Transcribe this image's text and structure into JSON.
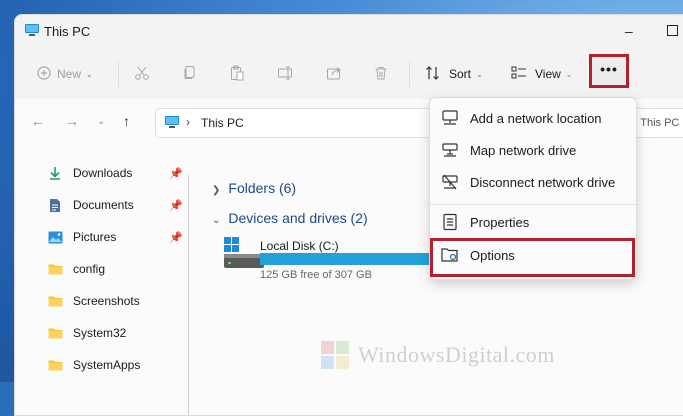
{
  "window": {
    "title": "This PC"
  },
  "toolbar": {
    "new_label": "New",
    "sort_label": "Sort",
    "view_label": "View",
    "more_label": "•••"
  },
  "address": {
    "location": "This PC",
    "search_placeholder": "arch This PC"
  },
  "sidebar": {
    "items": [
      {
        "label": "Downloads",
        "icon": "download-icon",
        "pinned": true
      },
      {
        "label": "Documents",
        "icon": "document-icon",
        "pinned": true
      },
      {
        "label": "Pictures",
        "icon": "pictures-icon",
        "pinned": true
      },
      {
        "label": "config",
        "icon": "folder-icon",
        "pinned": false
      },
      {
        "label": "Screenshots",
        "icon": "folder-icon",
        "pinned": false
      },
      {
        "label": "System32",
        "icon": "folder-icon",
        "pinned": false
      },
      {
        "label": "SystemApps",
        "icon": "folder-icon",
        "pinned": false
      }
    ]
  },
  "content": {
    "folders_label": "Folders (6)",
    "devices_label": "Devices and drives (2)",
    "drive": {
      "name": "Local Disk (C:)",
      "free_text": "125 GB free of 307 GB",
      "used_fraction": 0.59
    }
  },
  "menu": {
    "items": [
      {
        "label": "Add a network location",
        "icon": "network-location-icon"
      },
      {
        "label": "Map network drive",
        "icon": "map-drive-icon"
      },
      {
        "label": "Disconnect network drive",
        "icon": "disconnect-drive-icon"
      },
      {
        "label": "Properties",
        "icon": "properties-icon"
      },
      {
        "label": "Options",
        "icon": "options-icon"
      }
    ]
  },
  "watermark": {
    "text": "WindowsDigital.com"
  },
  "colors": {
    "highlight": "#b3222a",
    "accent": "#26a0da",
    "folder": "#f5c542"
  }
}
